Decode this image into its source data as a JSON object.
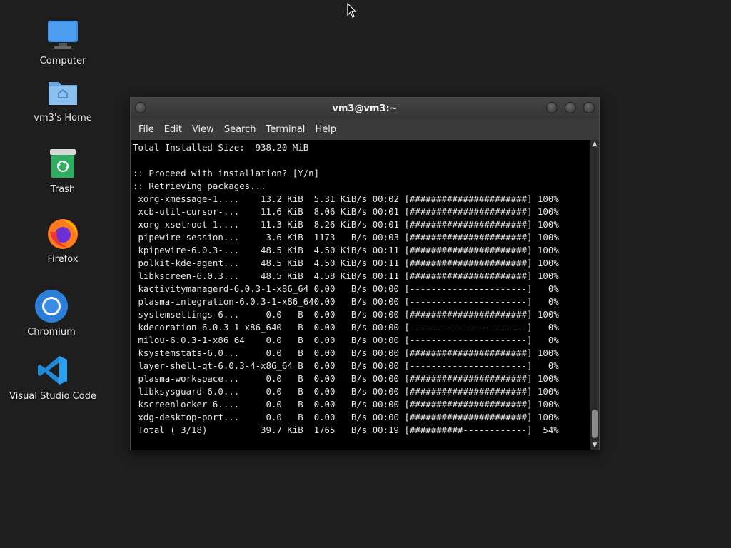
{
  "desktop": {
    "icons": [
      {
        "label": "Computer",
        "icon": "computer-icon"
      },
      {
        "label": "vm3's Home",
        "icon": "home-folder-icon"
      },
      {
        "label": "Trash",
        "icon": "trash-icon"
      },
      {
        "label": "Firefox",
        "icon": "firefox-icon"
      },
      {
        "label": "Chromium",
        "icon": "chromium-icon"
      },
      {
        "label": "Visual Studio Code",
        "icon": "vscode-icon"
      }
    ]
  },
  "window": {
    "title": "vm3@vm3:~",
    "menu": [
      "File",
      "Edit",
      "View",
      "Search",
      "Terminal",
      "Help"
    ]
  },
  "terminal": {
    "lines": [
      "Total Installed Size:  938.20 MiB",
      "",
      ":: Proceed with installation? [Y/n]",
      ":: Retrieving packages...",
      " xorg-xmessage-1....    13.2 KiB  5.31 KiB/s 00:02 [######################] 100%",
      " xcb-util-cursor-...    11.6 KiB  8.06 KiB/s 00:01 [######################] 100%",
      " xorg-xsetroot-1....    11.3 KiB  8.26 KiB/s 00:01 [######################] 100%",
      " pipewire-session...     3.6 KiB  1173   B/s 00:03 [######################] 100%",
      " kpipewire-6.0.3-...    48.5 KiB  4.50 KiB/s 00:11 [######################] 100%",
      " polkit-kde-agent...    48.5 KiB  4.50 KiB/s 00:11 [######################] 100%",
      " libkscreen-6.0.3...    48.5 KiB  4.58 KiB/s 00:11 [######################] 100%",
      " kactivitymanagerd-6.0.3-1-x86_64 0.00   B/s 00:00 [----------------------]   0%",
      " plasma-integration-6.0.3-1-x86_640.00   B/s 00:00 [----------------------]   0%",
      " systemsettings-6...     0.0   B  0.00   B/s 00:00 [######################] 100%",
      " kdecoration-6.0.3-1-x86_640   B  0.00   B/s 00:00 [----------------------]   0%",
      " milou-6.0.3-1-x86_64    0.0   B  0.00   B/s 00:00 [----------------------]   0%",
      " ksystemstats-6.0...     0.0   B  0.00   B/s 00:00 [######################] 100%",
      " layer-shell-qt-6.0.3-4-x86_64 B  0.00   B/s 00:00 [----------------------]   0%",
      " plasma-workspace...     0.0   B  0.00   B/s 00:00 [######################] 100%",
      " libksysguard-6.0...     0.0   B  0.00   B/s 00:00 [######################] 100%",
      " kscreenlocker-6....     0.0   B  0.00   B/s 00:00 [######################] 100%",
      " xdg-desktop-port...     0.0   B  0.00   B/s 00:00 [######################] 100%",
      " Total ( 3/18)          39.7 KiB  1765   B/s 00:19 [##########------------]  54%"
    ]
  },
  "colors": {
    "desktop_bg": "#1e1e1e",
    "terminal_bg": "#000000",
    "terminal_fg": "#e6e6e6",
    "window_chrome": "#3a3a3a"
  }
}
